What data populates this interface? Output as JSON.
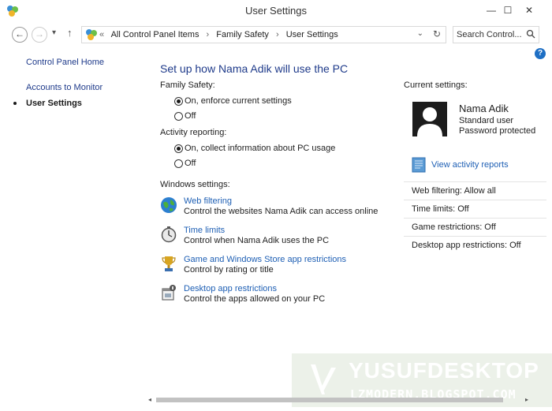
{
  "window": {
    "title": "User Settings",
    "controls": {
      "minimize": "—",
      "maximize": "☐",
      "close": "✕"
    }
  },
  "address_bar": {
    "overflow": "«",
    "crumbs": [
      "All Control Panel Items",
      "Family Safety",
      "User Settings"
    ],
    "separator": "›",
    "search_placeholder": "Search Control..."
  },
  "left_nav": {
    "items": [
      {
        "label": "Control Panel Home"
      },
      {
        "label": "Accounts to Monitor"
      },
      {
        "label": "User Settings",
        "current": true
      }
    ]
  },
  "main": {
    "heading": "Set up how Nama Adik will use the PC",
    "family_safety": {
      "label": "Family Safety:",
      "options": [
        "On, enforce current settings",
        "Off"
      ],
      "selected": 0
    },
    "activity_reporting": {
      "label": "Activity reporting:",
      "options": [
        "On, collect information about PC usage",
        "Off"
      ],
      "selected": 0
    },
    "windows_settings": {
      "label": "Windows settings:",
      "items": [
        {
          "icon": "globe-icon",
          "link": "Web filtering",
          "desc": "Control the websites Nama Adik can access online"
        },
        {
          "icon": "stopwatch-icon",
          "link": "Time limits",
          "desc": "Control when Nama Adik uses the PC"
        },
        {
          "icon": "trophy-icon",
          "link": "Game and Windows Store app restrictions",
          "desc": "Control by rating or title"
        },
        {
          "icon": "app-restrictions-icon",
          "link": "Desktop app restrictions",
          "desc": "Control the apps allowed on your PC"
        }
      ]
    }
  },
  "right": {
    "current_label": "Current settings:",
    "user": {
      "name": "Nama Adik",
      "type": "Standard user",
      "status": "Password protected"
    },
    "reports_link": "View activity reports",
    "stats": [
      "Web filtering:  Allow all",
      "Time limits:  Off",
      "Game restrictions:  Off",
      "Desktop app restrictions:  Off"
    ]
  },
  "watermark": {
    "main": "YUSUFDESKTOP",
    "sub": "LZMODERN.BLOGSPOT.COM"
  },
  "colors": {
    "link": "#1e5fb4",
    "heading": "#1e3a8a",
    "help": "#1e6fc4"
  }
}
